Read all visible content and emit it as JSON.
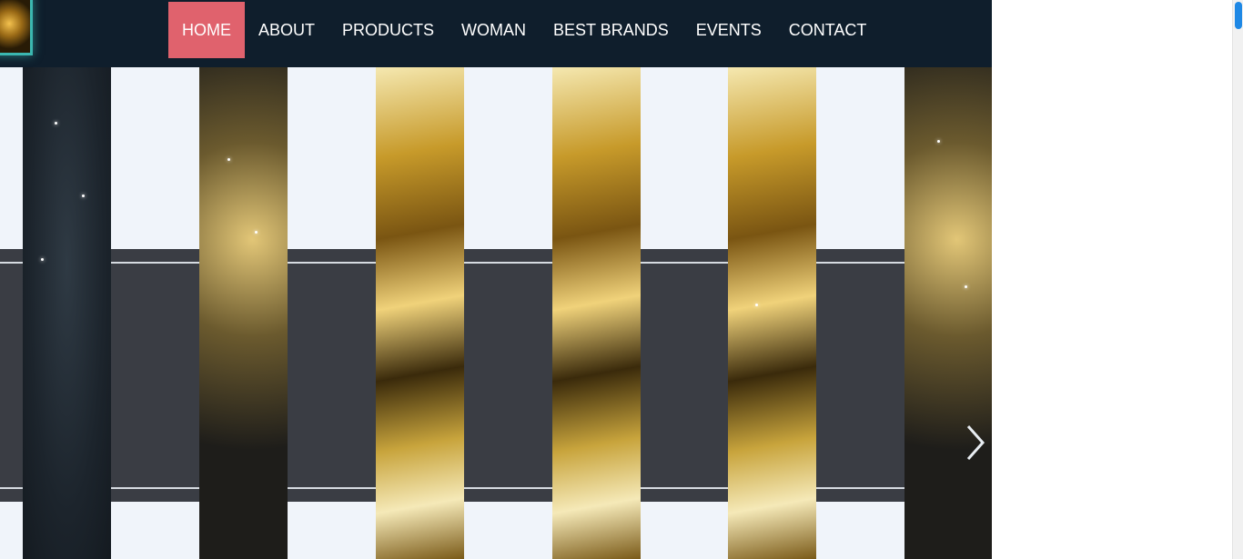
{
  "nav": {
    "items": [
      {
        "label": "HOME",
        "active": true
      },
      {
        "label": "ABOUT",
        "active": false
      },
      {
        "label": "PRODUCTS",
        "active": false
      },
      {
        "label": "WOMAN",
        "active": false
      },
      {
        "label": "BEST BRANDS",
        "active": false
      },
      {
        "label": "EVENTS",
        "active": false
      },
      {
        "label": "CONTACT",
        "active": false
      }
    ]
  },
  "hero": {
    "icons": {
      "next": "chevron-right-icon",
      "logo": "logo-image"
    }
  },
  "colors": {
    "navbar_bg": "#0f1e2c",
    "active_nav_bg": "#e0626d",
    "logo_border": "#3bb7b0",
    "accent_gold": "#e6b729",
    "scroll_thumb": "#1e88e5"
  }
}
